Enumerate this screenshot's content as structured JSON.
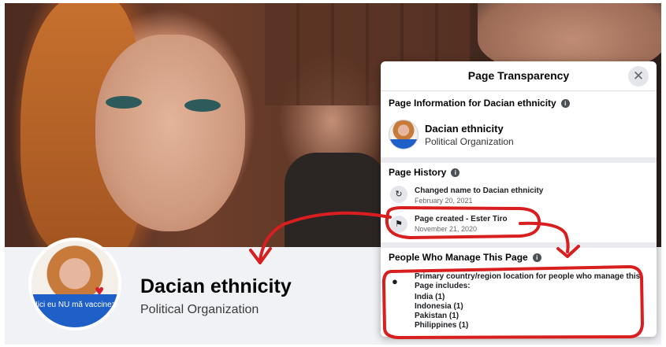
{
  "page": {
    "name": "Dacian ethnicity",
    "category": "Political Organization",
    "profile_banner": "Nici eu NU mă vaccinez!"
  },
  "dialog": {
    "title": "Page Transparency",
    "close_icon": "close-icon",
    "info_section": {
      "title": "Page Information for Dacian ethnicity",
      "name": "Dacian ethnicity",
      "category": "Political Organization"
    },
    "history_section": {
      "title": "Page History",
      "items": [
        {
          "icon": "rename-icon",
          "text": "Changed name to Dacian ethnicity",
          "date": "February 20, 2021"
        },
        {
          "icon": "flag-icon",
          "text": "Page created - Ester Tiro",
          "date": "November 21, 2020"
        }
      ]
    },
    "managers_section": {
      "title": "People Who Manage This Page",
      "description": "Primary country/region location for people who manage this Page includes:",
      "countries": [
        "India (1)",
        "Indonesia (1)",
        "Pakistan (1)",
        "Philippines (1)"
      ]
    }
  },
  "colors": {
    "annotation": "#d81e1e",
    "banner": "#1e5fc8"
  }
}
